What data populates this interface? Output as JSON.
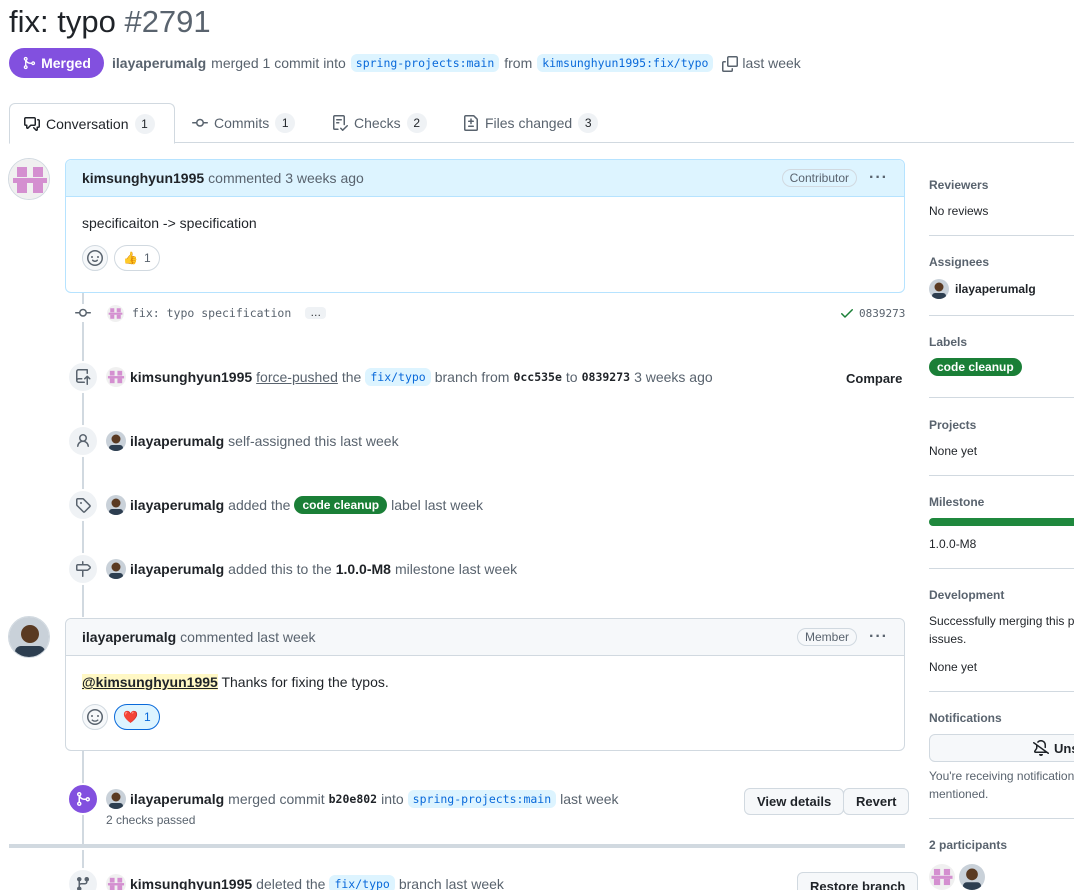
{
  "header": {
    "title": "fix: typo",
    "number": "#2791",
    "state": "Merged",
    "merger": "ilayaperumalg",
    "merged_text": "merged 1 commit into",
    "base_branch": "spring-projects:main",
    "from_text": "from",
    "head_branch": "kimsunghyun1995:fix/typo",
    "time": "last week"
  },
  "tabs": [
    {
      "label": "Conversation",
      "count": "1",
      "icon": "comment-discussion-icon"
    },
    {
      "label": "Commits",
      "count": "1",
      "icon": "git-commit-icon"
    },
    {
      "label": "Checks",
      "count": "2",
      "icon": "checklist-icon"
    },
    {
      "label": "Files changed",
      "count": "3",
      "icon": "file-diff-icon"
    }
  ],
  "first_comment": {
    "author": "kimsunghyun1995",
    "action": "commented 3 weeks ago",
    "role": "Contributor",
    "body": "specificaiton -> specification",
    "reaction_emoji": "👍",
    "reaction_count": "1"
  },
  "commit_row": {
    "message": "fix: typo specification",
    "more": "…",
    "sha": "0839273"
  },
  "force_push": {
    "author": "kimsunghyun1995",
    "action": "force-pushed",
    "the": "the",
    "branch": "fix/typo",
    "branch_from": "branch from",
    "from_sha": "0cc535e",
    "to": "to",
    "to_sha": "0839273",
    "time": "3 weeks ago",
    "compare": "Compare"
  },
  "self_assign": {
    "author": "ilayaperumalg",
    "text": "self-assigned this last week"
  },
  "label_event": {
    "author": "ilayaperumalg",
    "added": "added the",
    "label": "code cleanup",
    "tail": "label last week"
  },
  "milestone_event": {
    "author": "ilayaperumalg",
    "added": "added this to the",
    "milestone": "1.0.0-M8",
    "tail": "milestone last week"
  },
  "second_comment": {
    "author": "ilayaperumalg",
    "action": "commented last week",
    "role": "Member",
    "mention": "@kimsunghyun1995",
    "body": "Thanks for fixing the typos.",
    "reaction_emoji": "❤️",
    "reaction_count": "1"
  },
  "merge_event": {
    "author": "ilayaperumalg",
    "merged_commit": "merged commit",
    "sha": "b20e802",
    "into": "into",
    "branch": "spring-projects:main",
    "time": "last week",
    "checks": "2 checks passed",
    "view_details": "View details",
    "revert": "Revert"
  },
  "delete_event": {
    "author": "kimsunghyun1995",
    "deleted": "deleted the",
    "branch": "fix/typo",
    "tail": "branch last week",
    "restore": "Restore branch"
  },
  "sidebar": {
    "reviewers_h": "Reviewers",
    "reviewers_v": "No reviews",
    "assignees_h": "Assignees",
    "assignee": "ilayaperumalg",
    "labels_h": "Labels",
    "label": "code cleanup",
    "projects_h": "Projects",
    "projects_v": "None yet",
    "milestone_h": "Milestone",
    "milestone_v": "1.0.0-M8",
    "milestone_progress": 1.0,
    "development_h": "Development",
    "development_text1": "Successfully merging this pu",
    "development_text2": "issues.",
    "development_v": "None yet",
    "notifications_h": "Notifications",
    "notifications_btn": "Uns",
    "notifications_text1": "You're receiving notification",
    "notifications_text2": "mentioned.",
    "participants_h": "2 participants"
  },
  "colors": {
    "merged_purple": "#8250df",
    "label_green": "#1a7f37",
    "link_blue": "#0969da"
  }
}
